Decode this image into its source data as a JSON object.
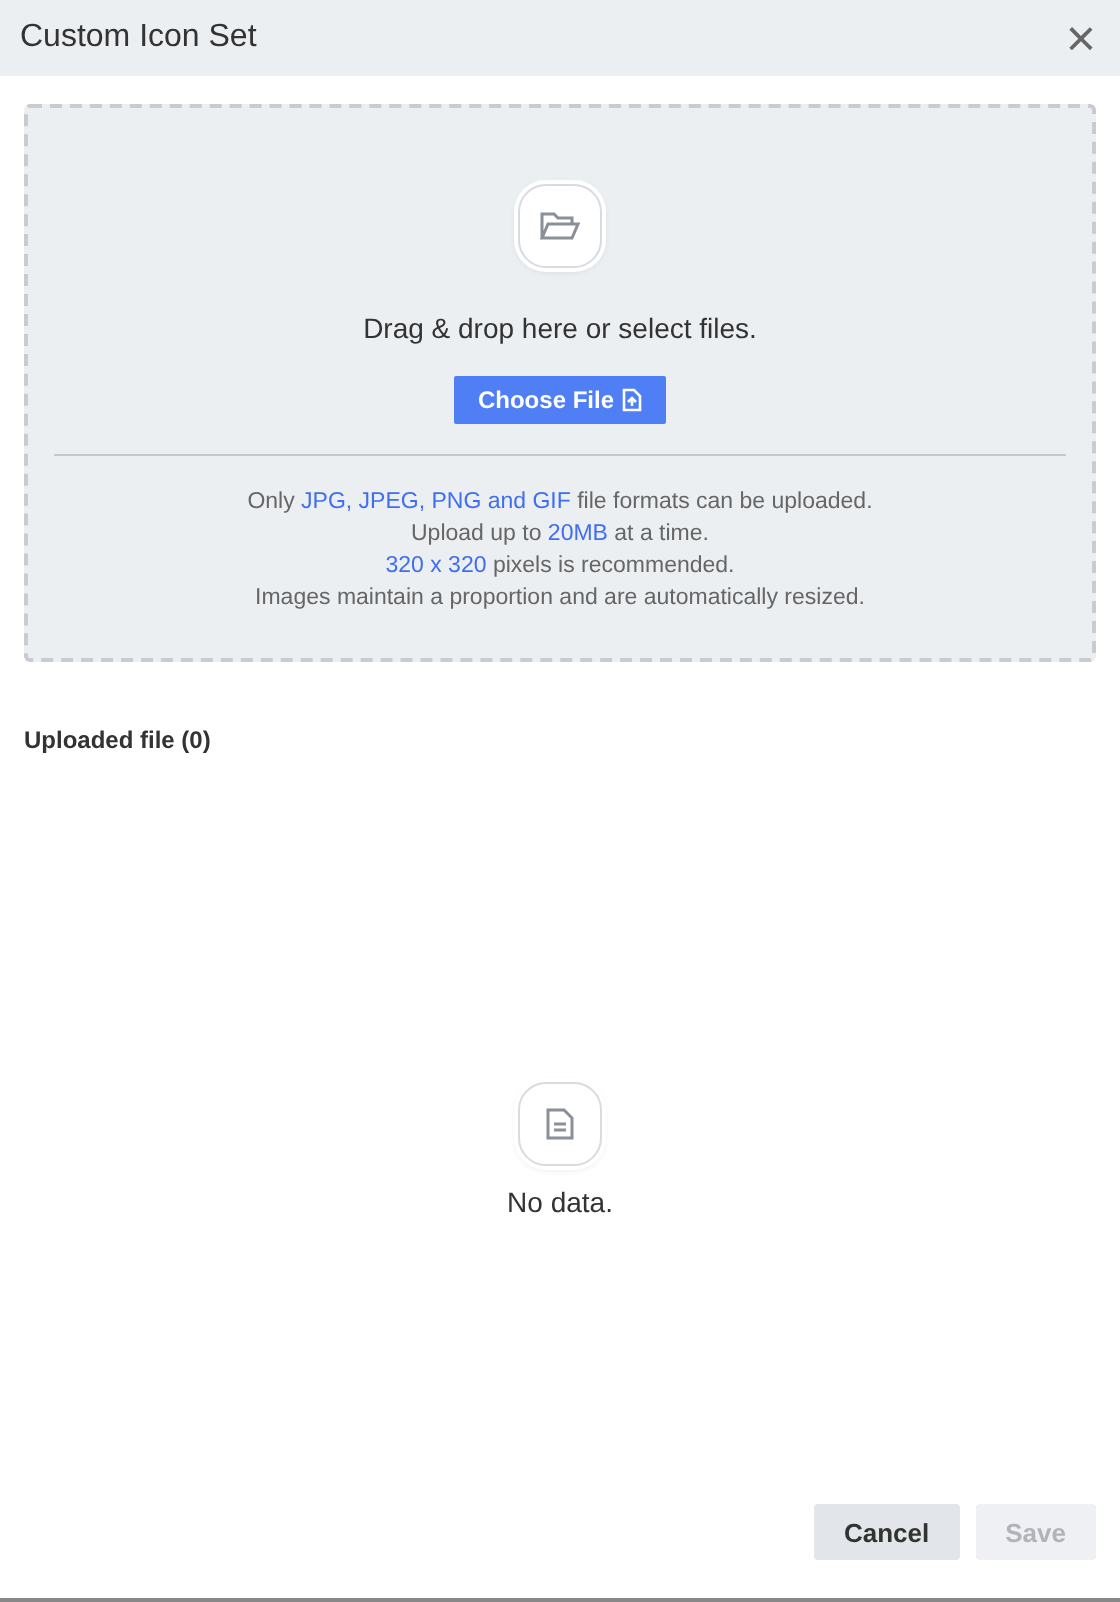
{
  "window": {
    "title": "Custom Icon Set",
    "close": "×"
  },
  "dropzone": {
    "prompt": "Drag & drop here or select files.",
    "button": "Choose File",
    "info": [
      [
        {
          "text": "Only ",
          "highlight": false
        },
        {
          "text": "JPG, JPEG, PNG and GIF",
          "highlight": true
        },
        {
          "text": " file formats can be uploaded.",
          "highlight": false
        }
      ],
      [
        {
          "text": "Upload up to ",
          "highlight": false
        },
        {
          "text": "20MB",
          "highlight": true
        },
        {
          "text": " at a time.",
          "highlight": false
        }
      ],
      [
        {
          "text": "320 x 320",
          "highlight": true
        },
        {
          "text": " pixels is recommended.",
          "highlight": false
        }
      ],
      [
        {
          "text": "Images maintain a proportion and are automatically resized.",
          "highlight": false
        }
      ]
    ]
  },
  "uploaded": {
    "heading": "Uploaded file (0)",
    "empty": "No data."
  },
  "buttons": [
    {
      "label": "Cancel",
      "disabled": false
    },
    {
      "label": "Save",
      "disabled": true
    }
  ]
}
